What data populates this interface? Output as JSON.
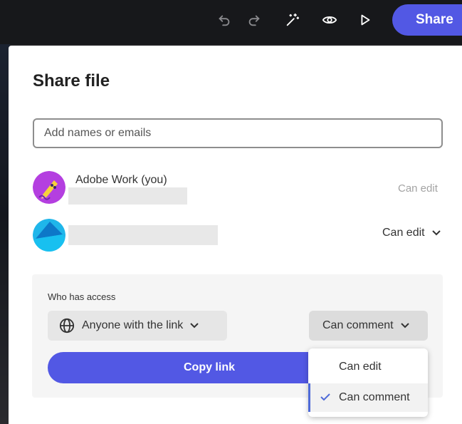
{
  "toolbar": {
    "icons": [
      "undo-icon",
      "redo-icon",
      "magic-wand-icon",
      "preview-eye-icon",
      "play-icon"
    ],
    "share_label": "Share",
    "accent": "#5258e4"
  },
  "dialog": {
    "title": "Share file",
    "search": {
      "placeholder": "Add names or emails",
      "value": ""
    },
    "people": [
      {
        "name": "Adobe Work (you)",
        "permission": "Can edit",
        "avatar": "pencil-avatar-icon"
      },
      {
        "name": "",
        "permission": "Can edit",
        "avatar": "user-avatar-icon"
      }
    ],
    "access": {
      "label": "Who has access",
      "scope": "Anyone with the link",
      "permission": "Can comment",
      "copy_label": "Copy link"
    },
    "permission_menu": {
      "options": [
        "Can edit",
        "Can comment"
      ],
      "selected": "Can comment"
    }
  }
}
